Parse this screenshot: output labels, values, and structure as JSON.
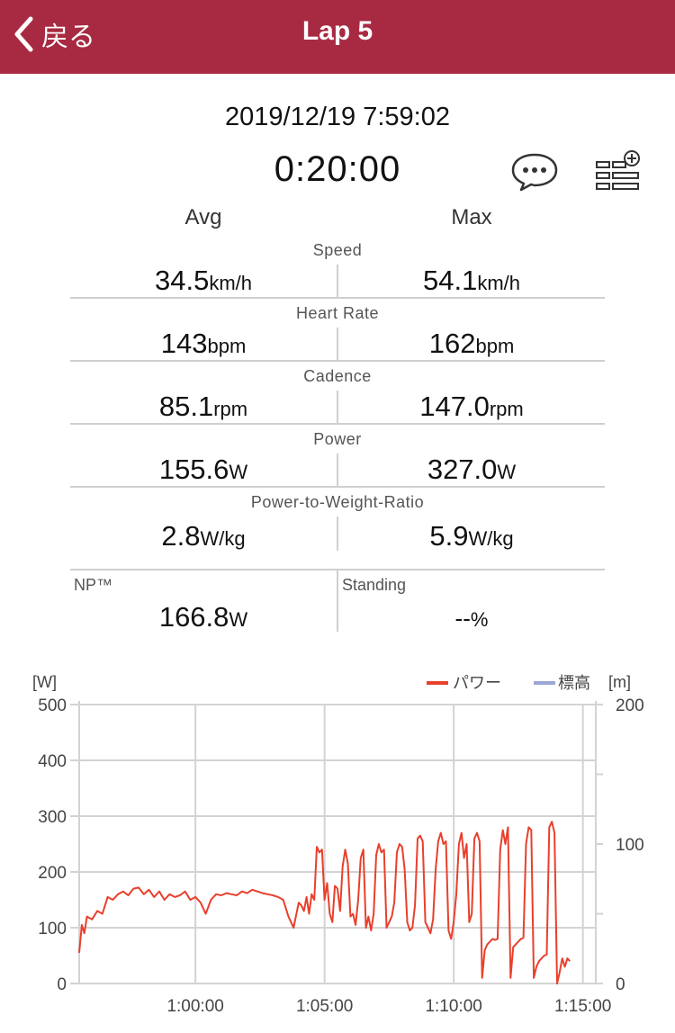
{
  "header": {
    "back_label": "戻る",
    "title": "Lap 5"
  },
  "summary": {
    "datetime": "2019/12/19 7:59:02",
    "duration": "0:20:00"
  },
  "columns": {
    "avg": "Avg",
    "max": "Max"
  },
  "metrics": [
    {
      "label": "Speed",
      "avg": "34.5",
      "avg_unit": "km/h",
      "max": "54.1",
      "max_unit": "km/h"
    },
    {
      "label": "Heart Rate",
      "avg": "143",
      "avg_unit": "bpm",
      "max": "162",
      "max_unit": "bpm"
    },
    {
      "label": "Cadence",
      "avg": "85.1",
      "avg_unit": "rpm",
      "max": "147.0",
      "max_unit": "rpm"
    },
    {
      "label": "Power",
      "avg": "155.6",
      "avg_unit": "W",
      "max": "327.0",
      "max_unit": "W"
    },
    {
      "label": "Power-to-Weight-Ratio",
      "avg": "2.8",
      "avg_unit": "W/kg",
      "max": "5.9",
      "max_unit": "W/kg"
    }
  ],
  "extra": {
    "np": {
      "label": "NP™",
      "value": "166.8",
      "unit": "W"
    },
    "standing": {
      "label": "Standing",
      "value": "--",
      "unit": "%"
    }
  },
  "icons": {
    "comment": "speech-bubble-icon",
    "list": "list-add-icon",
    "back": "chevron-left-icon"
  },
  "colors": {
    "header": "#a82a42",
    "power": "#e8402c",
    "elevation": "#9aa6d6",
    "grid": "#d3d3d3"
  },
  "chart_data": {
    "type": "line",
    "legend": [
      "パワー",
      "標高"
    ],
    "legend_position": "top-right",
    "y_left": {
      "unit": "[W]",
      "ylim": [
        0,
        500
      ],
      "ticks": [
        "0",
        "100",
        "200",
        "300",
        "400",
        "500"
      ]
    },
    "y_right": {
      "unit": "[m]",
      "ylim": [
        0,
        200
      ],
      "ticks": [
        "0",
        "100",
        "200"
      ]
    },
    "x": {
      "xlim": [
        "0:55:30",
        "1:15:30"
      ],
      "ticks": [
        "1:00:00",
        "1:05:00",
        "1:10:00",
        "1:15:00"
      ]
    },
    "grid": true,
    "series": [
      {
        "name": "パワー",
        "x_minutes": [
          55.5,
          55.6,
          55.7,
          55.8,
          56,
          56.2,
          56.4,
          56.6,
          56.8,
          57,
          57.2,
          57.4,
          57.6,
          57.8,
          58,
          58.2,
          58.4,
          58.6,
          58.8,
          59,
          59.2,
          59.4,
          59.6,
          59.8,
          60,
          60.2,
          60.4,
          60.6,
          60.8,
          61,
          61.2,
          61.4,
          61.6,
          61.8,
          62,
          62.2,
          62.4,
          62.6,
          62.8,
          63,
          63.2,
          63.4,
          63.6,
          63.8,
          64,
          64.1,
          64.2,
          64.3,
          64.4,
          64.5,
          64.6,
          64.7,
          64.8,
          64.9,
          65,
          65.1,
          65.2,
          65.3,
          65.4,
          65.5,
          65.6,
          65.7,
          65.8,
          65.9,
          66,
          66.1,
          66.2,
          66.3,
          66.4,
          66.5,
          66.6,
          66.7,
          66.8,
          66.9,
          67,
          67.1,
          67.2,
          67.3,
          67.4,
          67.5,
          67.6,
          67.7,
          67.8,
          67.9,
          68,
          68.1,
          68.2,
          68.3,
          68.4,
          68.5,
          68.6,
          68.7,
          68.8,
          68.9,
          69,
          69.1,
          69.2,
          69.3,
          69.4,
          69.5,
          69.6,
          69.7,
          69.8,
          69.9,
          70,
          70.1,
          70.2,
          70.3,
          70.4,
          70.5,
          70.6,
          70.7,
          70.8,
          70.9,
          71,
          71.1,
          71.2,
          71.3,
          71.4,
          71.5,
          71.6,
          71.7,
          71.8,
          71.9,
          72,
          72.1,
          72.2,
          72.3,
          72.4,
          72.5,
          72.6,
          72.7,
          72.8,
          72.9,
          73,
          73.1,
          73.2,
          73.3,
          73.4,
          73.5,
          73.6,
          73.7,
          73.8,
          73.9,
          74,
          74.1,
          74.2,
          74.3,
          74.4,
          74.5,
          74.6,
          74.7,
          74.8,
          74.9,
          75,
          75.1,
          75.2,
          75.3
        ],
        "values": [
          55,
          105,
          90,
          120,
          115,
          130,
          125,
          155,
          150,
          160,
          165,
          158,
          170,
          172,
          160,
          168,
          155,
          165,
          150,
          160,
          155,
          158,
          165,
          150,
          155,
          145,
          125,
          150,
          160,
          158,
          162,
          160,
          158,
          165,
          162,
          168,
          165,
          162,
          160,
          158,
          155,
          150,
          120,
          100,
          145,
          140,
          130,
          155,
          125,
          160,
          150,
          245,
          235,
          240,
          150,
          180,
          125,
          110,
          175,
          170,
          130,
          210,
          240,
          215,
          120,
          125,
          105,
          150,
          225,
          240,
          100,
          120,
          95,
          125,
          230,
          250,
          235,
          240,
          100,
          110,
          120,
          145,
          235,
          250,
          245,
          205,
          110,
          95,
          100,
          140,
          260,
          265,
          255,
          110,
          100,
          90,
          115,
          205,
          255,
          270,
          250,
          255,
          95,
          80,
          110,
          160,
          250,
          270,
          225,
          250,
          110,
          125,
          260,
          270,
          255,
          10,
          60,
          70,
          75,
          80,
          78,
          80,
          240,
          275,
          250,
          280,
          10,
          65,
          70,
          75,
          80,
          82,
          250,
          280,
          275,
          10,
          30,
          40,
          45,
          50,
          52,
          280,
          290,
          270,
          0,
          20,
          45,
          30,
          45,
          40
        ]
      },
      {
        "name": "標高",
        "values": []
      }
    ]
  }
}
